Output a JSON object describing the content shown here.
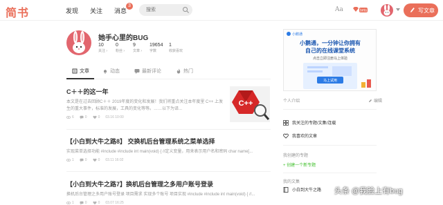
{
  "nav": {
    "logo": "简书",
    "links": [
      "发现",
      "关注",
      "消息"
    ],
    "message_badge": "3",
    "search_placeholder": "搜索",
    "aa_label": "Aa",
    "beta_label": "beta",
    "write_button": "写文章",
    "accent_color": "#ea6f5a"
  },
  "profile": {
    "name": "她手心里的BUG",
    "stats": [
      {
        "value": "10",
        "label": "关注 ›"
      },
      {
        "value": "0",
        "label": "粉丝 ›"
      },
      {
        "value": "9",
        "label": "文章 ›"
      },
      {
        "value": "19654",
        "label": "字数"
      },
      {
        "value": "1",
        "label": "收获喜欢"
      }
    ]
  },
  "tabs": [
    "文章",
    "动态",
    "最新评论",
    "热门"
  ],
  "articles": [
    {
      "title": "C＋＋的这一年",
      "abstract": "本文是在过去回顾C＋＋ 2019年度的变化和发展！我们将重点关注本年度里 C++ 上发生的重大事件，标准的发展，工具的变化等等。……以下为译...",
      "views": "6",
      "comments": "0",
      "likes": "0",
      "time": "03.16 10:00"
    },
    {
      "title": "【小白到大牛之路8】 交换机后台管理系统之菜单选择",
      "abstract": "实现菜单选择功能 #include #include int main(void) { //定义变量，用来表示用户名和密码 char name[...",
      "views": "1",
      "comments": "0",
      "likes": "0",
      "time": "03.11 16:02"
    },
    {
      "title": "【小白到大牛之路7】换机后台管理之多用户账号登录",
      "abstract": "换机后台管理之多用户账号登录 项目需求 实现多个账号 项目实现 #include #include int main(void) { //...",
      "views": "1",
      "comments": "0",
      "likes": "0",
      "time": "03.07 16:25"
    }
  ],
  "sidebar": {
    "ad": {
      "brand": "小鹅通",
      "line1": "小鹅通，一分钟让你拥有",
      "line2": "自己的在线课堂系统",
      "line3": "点击立即注册马上体验",
      "button": "马上试用"
    },
    "intro_label": "个人介绍",
    "edit_label": "编辑",
    "links": [
      "我关注的专题/文集/连载",
      "我喜欢的文章"
    ],
    "created_label": "我创建的专题",
    "create_link": "+ 创建一个新专题",
    "anthology_label": "我的文集",
    "anthology_item": "小白到大牛之路"
  },
  "watermark": "头条 @我脸上有bug"
}
